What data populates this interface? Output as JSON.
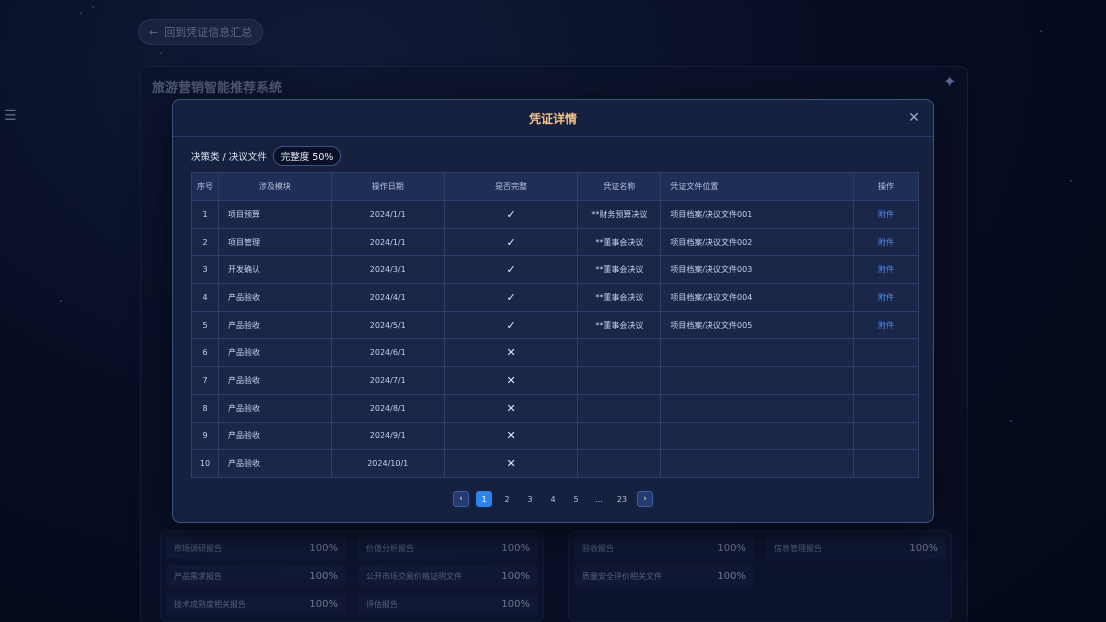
{
  "back_button": {
    "label": "回到凭证信息汇总",
    "icon": "arrow-left-icon"
  },
  "background_panel": {
    "title": "旅游营销智能推荐系统",
    "reports": [
      {
        "label": "市场调研报告",
        "pct": "100%"
      },
      {
        "label": "价值分析报告",
        "pct": "100%"
      },
      {
        "label": "产品需求报告",
        "pct": "100%"
      },
      {
        "label": "公开市场交易价格证明文件",
        "pct": "100%"
      },
      {
        "label": "技术成熟度相关报告",
        "pct": "100%"
      },
      {
        "label": "评估报告",
        "pct": "100%"
      },
      {
        "label": "验收报告",
        "pct": "100%"
      },
      {
        "label": "信息管理报告",
        "pct": "100%"
      },
      {
        "label": "质量安全评价相关文件",
        "pct": "100%"
      }
    ]
  },
  "modal": {
    "title": "凭证详情",
    "path": "决策类 / 决议文件",
    "completeness": "完整度 50%",
    "columns": [
      "序号",
      "涉及模块",
      "操作日期",
      "是否完整",
      "凭证名称",
      "凭证文件位置",
      "操作"
    ],
    "rows": [
      {
        "idx": "1",
        "module": "项目预算",
        "date": "2024/1/1",
        "complete": "✓",
        "name": "**财务预算决议",
        "location": "项目档案/决议文件001",
        "action": "附件"
      },
      {
        "idx": "2",
        "module": "项目管理",
        "date": "2024/1/1",
        "complete": "✓",
        "name": "**董事会决议",
        "location": "项目档案/决议文件002",
        "action": "附件"
      },
      {
        "idx": "3",
        "module": "开发确认",
        "date": "2024/3/1",
        "complete": "✓",
        "name": "**董事会决议",
        "location": "项目档案/决议文件003",
        "action": "附件"
      },
      {
        "idx": "4",
        "module": "产品验收",
        "date": "2024/4/1",
        "complete": "✓",
        "name": "**董事会决议",
        "location": "项目档案/决议文件004",
        "action": "附件"
      },
      {
        "idx": "5",
        "module": "产品验收",
        "date": "2024/5/1",
        "complete": "✓",
        "name": "**董事会决议",
        "location": "项目档案/决议文件005",
        "action": "附件"
      },
      {
        "idx": "6",
        "module": "产品验收",
        "date": "2024/6/1",
        "complete": "✕",
        "name": "",
        "location": "",
        "action": ""
      },
      {
        "idx": "7",
        "module": "产品验收",
        "date": "2024/7/1",
        "complete": "✕",
        "name": "",
        "location": "",
        "action": ""
      },
      {
        "idx": "8",
        "module": "产品验收",
        "date": "2024/8/1",
        "complete": "✕",
        "name": "",
        "location": "",
        "action": ""
      },
      {
        "idx": "9",
        "module": "产品验收",
        "date": "2024/9/1",
        "complete": "✕",
        "name": "",
        "location": "",
        "action": ""
      },
      {
        "idx": "10",
        "module": "产品验收",
        "date": "2024/10/1",
        "complete": "✕",
        "name": "",
        "location": "",
        "action": ""
      }
    ],
    "pagination": {
      "prev": "‹",
      "pages": [
        "1",
        "2",
        "3",
        "4",
        "5",
        "...",
        "23"
      ],
      "active": "1",
      "next": "›"
    }
  },
  "colors": {
    "title_accent": "#f3c38a",
    "link": "#4e8cf1",
    "page_active": "#2a86ef"
  }
}
